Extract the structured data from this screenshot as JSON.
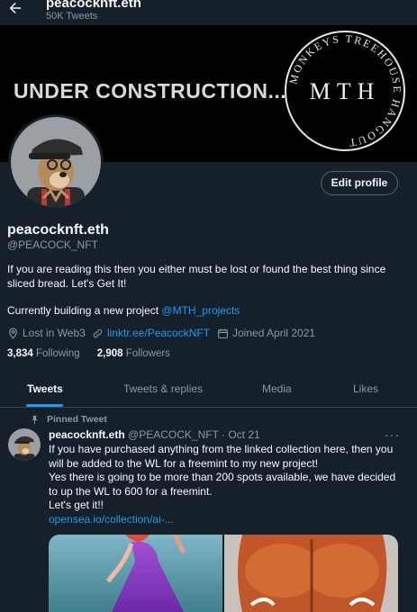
{
  "header": {
    "title": "peacocknft.eth",
    "tweets_count": "50K Tweets"
  },
  "banner": {
    "text": "UNDER CONSTRUCTION...",
    "logo_initials": "MTH",
    "logo_ring_text": "MONKEYS TREEHOUSE HANGOUT"
  },
  "profile": {
    "edit_label": "Edit profile",
    "name": "peacocknft.eth",
    "handle": "@PEACOCK_NFT",
    "bio_line": "If you are reading this then you either must be lost or found the best thing since sliced bread. Let's Get It!",
    "bio_building": "Currently building a new project ",
    "bio_link": "@MTH_projects",
    "location": "Lost in Web3",
    "website": "linktr.ee/PeacockNFT",
    "joined": "Joined April 2021",
    "following_count": "3,834",
    "following_label": "Following",
    "followers_count": "2,908",
    "followers_label": "Followers"
  },
  "tabs": [
    "Tweets",
    "Tweets & replies",
    "Media",
    "Likes"
  ],
  "tweet": {
    "pinned_label": "Pinned Tweet",
    "name": "peacocknft.eth",
    "handle_date": "@PEACOCK_NFT · Oct 21",
    "line1": "If you have purchased anything from the linked collection here, then you will be added to the WL for a freemint to my new project!",
    "line2": "Yes there is going to be more than 200 spots available, we have decided to up the WL to 600 for a freemint.",
    "line3": "Let's get it!!",
    "link": "opensea.io/collection/ai-..."
  },
  "colors": {
    "background": "#15202b",
    "accent": "#1d9bf0",
    "muted": "#8b98a5"
  },
  "icons": [
    "back-arrow-icon",
    "location-icon",
    "link-icon",
    "calendar-icon",
    "pin-icon",
    "more-icon"
  ]
}
